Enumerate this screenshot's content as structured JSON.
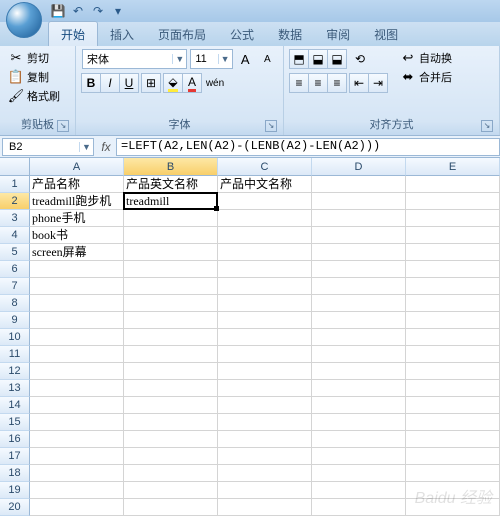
{
  "qat": {
    "save": "💾",
    "undo": "↶",
    "redo": "↷"
  },
  "tabs": [
    "开始",
    "插入",
    "页面布局",
    "公式",
    "数据",
    "审阅",
    "视图"
  ],
  "activeTab": 0,
  "clipboard": {
    "cut": "剪切",
    "copy": "复制",
    "paste": "格式刷",
    "label": "剪贴板",
    "cutIcon": "✂",
    "copyIcon": "📋",
    "brushIcon": "🖌"
  },
  "font": {
    "name": "宋体",
    "size": "11",
    "label": "字体",
    "bold": "B",
    "italic": "I",
    "underline": "U"
  },
  "align": {
    "label": "对齐方式",
    "wrap": "自动换",
    "merge": "合并后"
  },
  "nameBox": "B2",
  "formula": "=LEFT(A2,LEN(A2)-(LENB(A2)-LEN(A2)))",
  "columns": [
    "A",
    "B",
    "C",
    "D",
    "E"
  ],
  "activeCol": 1,
  "activeRow": 1,
  "cells": [
    [
      "产品名称",
      "产品英文名称",
      "产品中文名称",
      "",
      ""
    ],
    [
      "treadmill跑步机",
      "treadmill",
      "",
      "",
      ""
    ],
    [
      "phone手机",
      "",
      "",
      "",
      ""
    ],
    [
      "book书",
      "",
      "",
      "",
      ""
    ],
    [
      "screen屏幕",
      "",
      "",
      "",
      ""
    ]
  ],
  "rowCount": 20,
  "chart_data": {
    "type": "table",
    "headers": [
      "产品名称",
      "产品英文名称",
      "产品中文名称"
    ],
    "rows": [
      [
        "treadmill跑步机",
        "treadmill",
        ""
      ],
      [
        "phone手机",
        "",
        ""
      ],
      [
        "book书",
        "",
        ""
      ],
      [
        "screen屏幕",
        "",
        ""
      ]
    ]
  },
  "watermark": "Baidu 经验"
}
